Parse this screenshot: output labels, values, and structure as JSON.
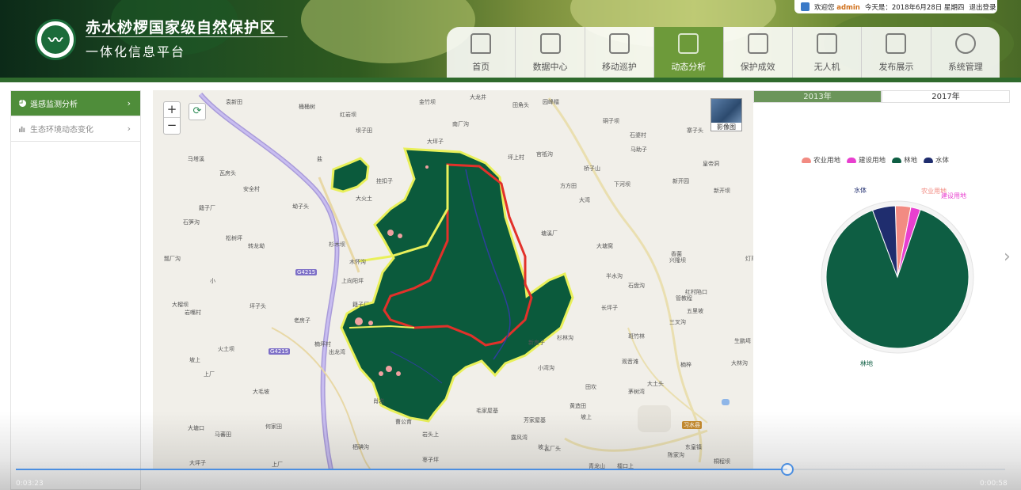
{
  "header": {
    "title": "赤水桫椤国家级自然保护区",
    "subtitle": "一体化信息平台",
    "user": {
      "welcome": "欢迎您",
      "name": "admin",
      "date": "今天是：2018年6月28日 星期四",
      "logout": "退出登录"
    },
    "nav": [
      {
        "label": "首页",
        "icon": "home-icon"
      },
      {
        "label": "数据中心",
        "icon": "database-icon"
      },
      {
        "label": "移动巡护",
        "icon": "car-icon"
      },
      {
        "label": "动态分析",
        "icon": "analysis-icon",
        "active": true
      },
      {
        "label": "保护成效",
        "icon": "clipboard-icon"
      },
      {
        "label": "无人机",
        "icon": "drone-icon"
      },
      {
        "label": "发布展示",
        "icon": "display-icon"
      },
      {
        "label": "系统管理",
        "icon": "gear-icon"
      }
    ]
  },
  "sidebar": {
    "items": [
      {
        "label": "遥感监测分析",
        "icon": "pie-icon",
        "active": true
      },
      {
        "label": "生态环境动态变化",
        "icon": "bar-chart-icon"
      }
    ]
  },
  "map": {
    "zoom_in": "+",
    "zoom_out": "−",
    "refresh": "⟳",
    "imagery_label": "影像图",
    "highway_labels": [
      "G4215",
      "G4215"
    ],
    "town_label": "习水县",
    "places": [
      "袁新田",
      "桶桶树",
      "红岩坝",
      "金竹坝",
      "大龙井",
      "田角头",
      "园峰檑",
      "坝子田",
      "南厂沟",
      "硐子坝",
      "石婆村",
      "寨子头",
      "公",
      "盐",
      "大坪子",
      "坪上村",
      "官祗沟",
      "马助子",
      "皇帝洞",
      "马塔溪",
      "瓦房头",
      "挂扣子",
      "大火土",
      "方方田",
      "桥子山",
      "下河坝",
      "新开园",
      "新开坝",
      "安全村",
      "坳子头",
      "籍子厂",
      "大湾",
      "石笋沟",
      "松树坪",
      "转龙坳",
      "杉木坝",
      "塘溪厂",
      "大塘窝",
      "香菌",
      "瓢厂沟",
      "木怀沟",
      "兴隆坝",
      "灯草坝",
      "小",
      "上向阳坪",
      "半水沟",
      "石盘沟",
      "红村陷口",
      "管教程",
      "大榴坝",
      "坪子头",
      "岩嘴村",
      "籍子厂",
      "长坪子",
      "五里坡",
      "三叉沟",
      "老房子",
      "楠坪村",
      "出龙湾",
      "新房子",
      "杉林沟",
      "斑竹林",
      "生鹏塆",
      "坡上",
      "火土坝",
      "上厂",
      "观音滩",
      "楠梓",
      "大林沟",
      "小湾沟",
      "大土头",
      "田坎",
      "茅树湾",
      "大毛坡",
      "肖岩",
      "毛家屋基",
      "黄造田",
      "坡上",
      "大塘口",
      "曹公育",
      "芳家屋基",
      "马蕃田",
      "何家田",
      "岩头上",
      "露风湾",
      "河坝",
      "坡上",
      "东皇镇",
      "瓦厂头",
      "栖碘沟",
      "大坪子",
      "上厂",
      "枣子坪",
      "青龙山",
      "檑口上",
      "陈家沟",
      "桐程坝"
    ]
  },
  "right_panel": {
    "year_tabs": [
      "2013年",
      "2017年"
    ],
    "legend_title_hidden": "",
    "colors": {
      "agriculture": "#f28b82",
      "construction": "#e83fcf",
      "forest": "#0e5e43",
      "water": "#1f2d6e"
    }
  },
  "chart_data": {
    "type": "pie",
    "categories": [
      "农业用地",
      "建设用地",
      "林地",
      "水体"
    ],
    "values": [
      3.5,
      2.2,
      89.1,
      5.2
    ],
    "title": "",
    "legend": "top",
    "labels": [
      "农业用地",
      "建设用地",
      "林地",
      "水体"
    ]
  },
  "video": {
    "elapsed": "0:03:23",
    "remaining": "0:00:58",
    "progress": 0.78
  }
}
